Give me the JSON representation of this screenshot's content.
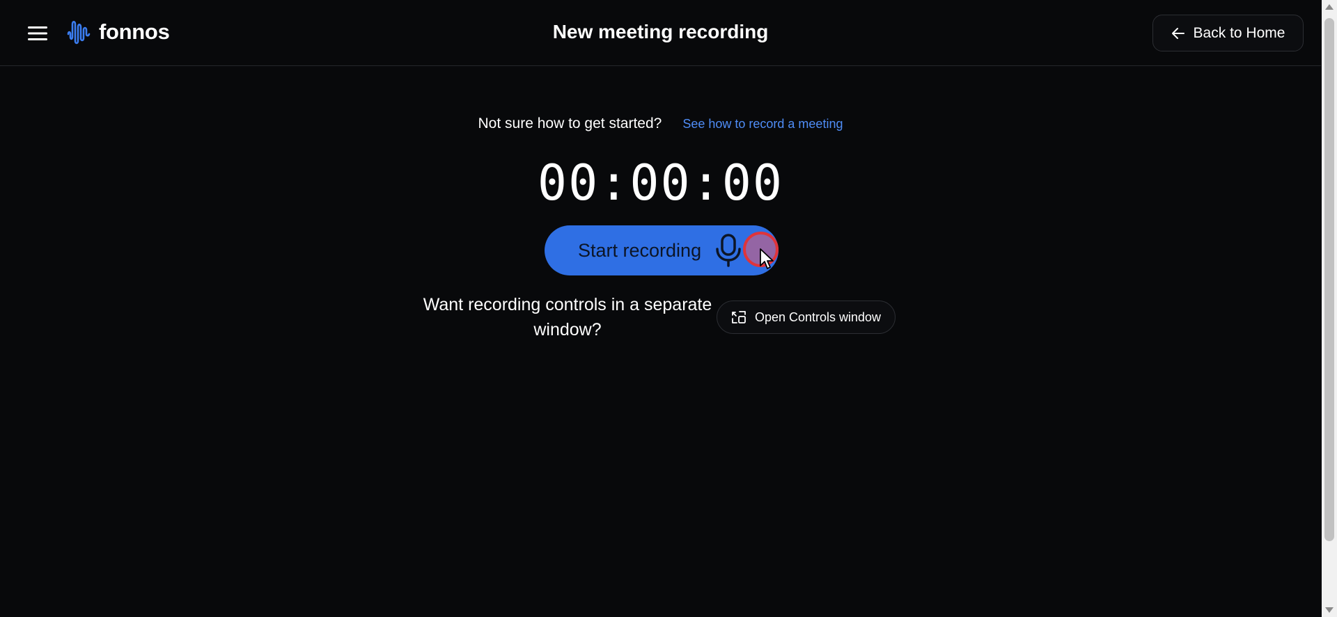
{
  "header": {
    "brand_name": "fonnos",
    "title": "New meeting recording",
    "back_label": "Back to Home",
    "menu_icon": "hamburger-menu-icon",
    "logo_icon": "waveform-logo-icon",
    "back_icon": "arrow-left-icon"
  },
  "help": {
    "prompt": "Not sure how to get started?",
    "link_text": "See how to record a meeting"
  },
  "timer": {
    "display": "00:00:00"
  },
  "recording": {
    "start_label": "Start recording",
    "mic_icon": "microphone-icon"
  },
  "controls": {
    "question": "Want recording controls in a separate window?",
    "button_label": "Open Controls window",
    "button_icon": "open-window-icon"
  },
  "colors": {
    "background": "#08090b",
    "accent": "#2f6fe4",
    "link": "#4f8df7",
    "logo": "#3b7df0"
  }
}
